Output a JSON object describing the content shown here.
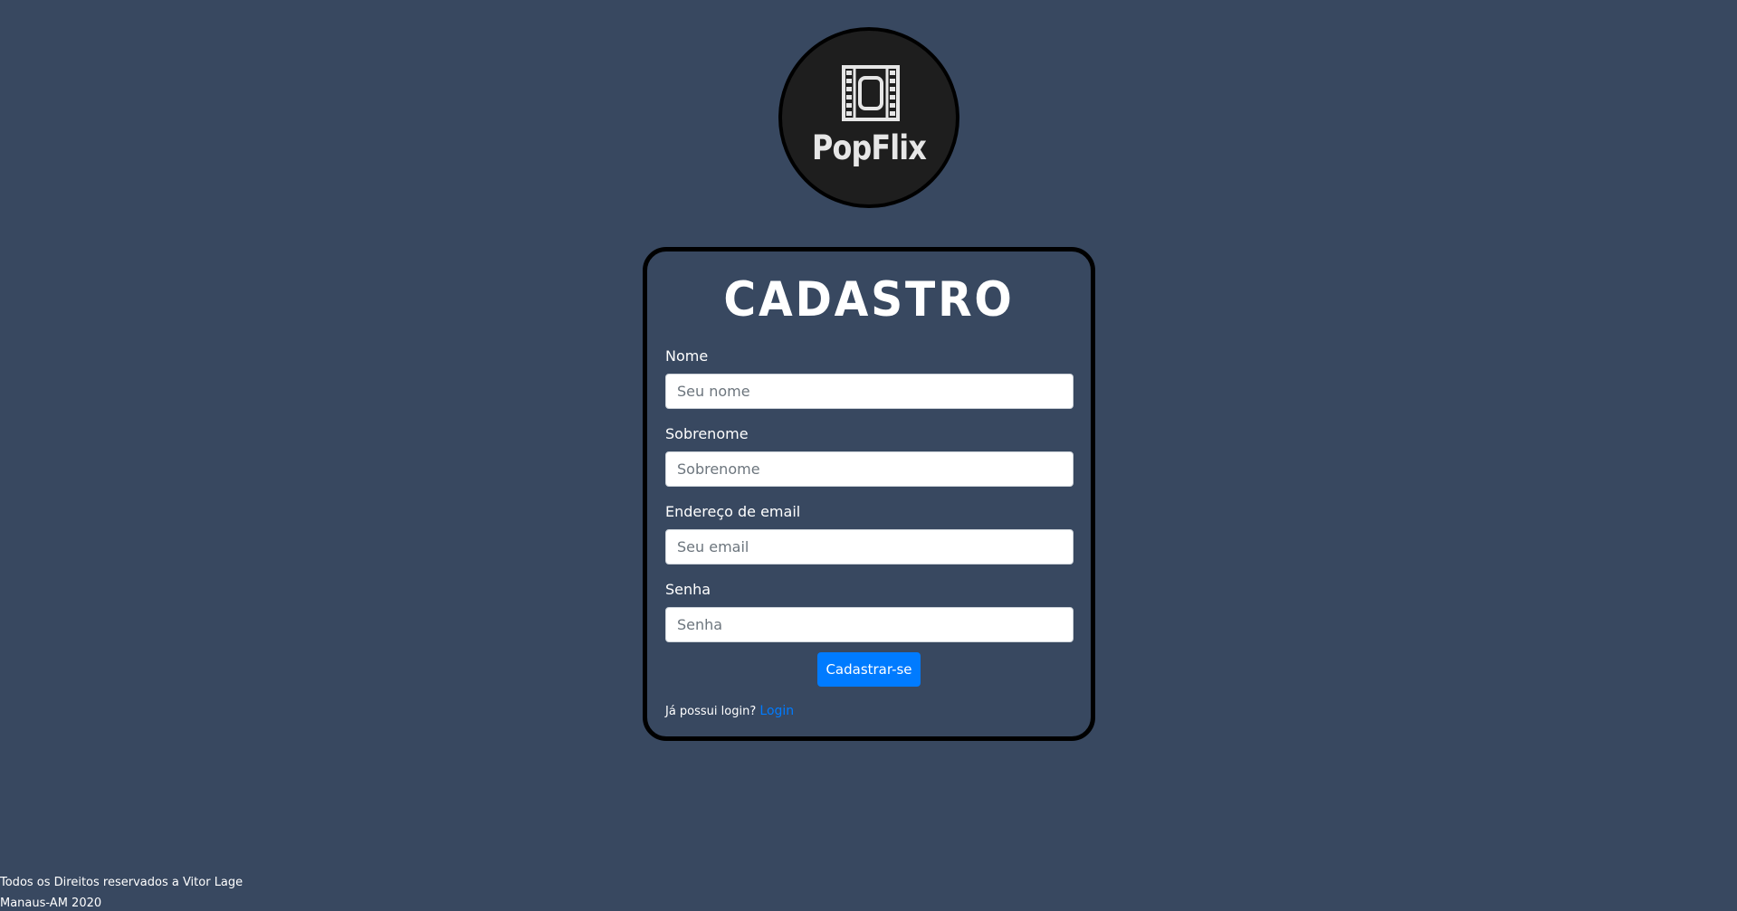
{
  "logo": {
    "icon": "film-icon",
    "text": "PopFlix"
  },
  "form": {
    "title": "CADASTRO",
    "fields": [
      {
        "label": "Nome",
        "placeholder": "Seu nome",
        "value": ""
      },
      {
        "label": "Sobrenome",
        "placeholder": "Sobrenome",
        "value": ""
      },
      {
        "label": "Endereço de email",
        "placeholder": "Seu email",
        "value": ""
      },
      {
        "label": "Senha",
        "placeholder": "Senha",
        "value": ""
      }
    ],
    "submit_label": "Cadastrar-se",
    "login_prompt": "Já possui login?",
    "login_link": "Login"
  },
  "footer": {
    "line1": "Todos os Direitos reservados a Vitor Lage",
    "line2": "Manaus-AM 2020"
  },
  "colors": {
    "background": "#384860",
    "logo_circle": "#1e1e1e",
    "border": "#000000",
    "primary": "#007bff"
  }
}
